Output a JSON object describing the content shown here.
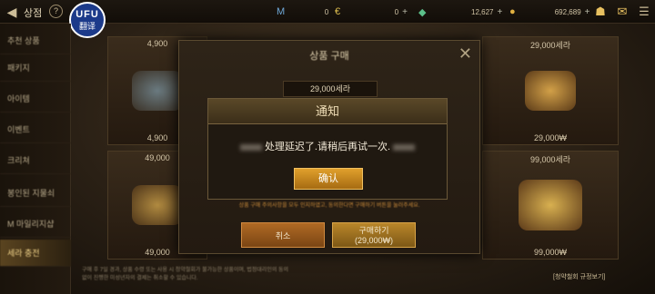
{
  "topbar": {
    "back_icon": "back-arrow-icon",
    "title": "상점",
    "help": "?",
    "currency": [
      {
        "icon": "M",
        "value": "0",
        "color": "#6fa8d8"
      },
      {
        "icon": "€",
        "value": "0",
        "color": "#e0c050"
      },
      {
        "icon": "◆",
        "value": "12,627",
        "color": "#5cc08a"
      },
      {
        "icon": "●",
        "value": "692,689",
        "color": "#e0b040"
      }
    ]
  },
  "translator_badge": {
    "line1": "UFU",
    "line2": "翻译"
  },
  "sidebar": {
    "items": [
      {
        "label": "추천 상품"
      },
      {
        "label": "패키지"
      },
      {
        "label": "아이템"
      },
      {
        "label": "이벤트"
      },
      {
        "label": "크리쳐"
      },
      {
        "label": "봉인된 지물쇠"
      },
      {
        "label": "M 마일리지샵"
      },
      {
        "label": "세라 충전"
      }
    ]
  },
  "cards": [
    {
      "top": "4,900",
      "bottom": "4,900"
    },
    {
      "top": "49,000",
      "bottom": "49,000"
    },
    {
      "top": "29,000세라",
      "bottom": "29,000₩"
    },
    {
      "top": "99,000세라",
      "bottom": "99,000₩"
    }
  ],
  "purchase_dialog": {
    "title": "상품 구매",
    "close": "✕",
    "amount": "29,000세라",
    "notice": "상품 구매 주의사항을 모두 인지하였고, 동의한다면 구매하기 버튼을 눌러주세요.",
    "cancel": "취소",
    "buy_line1": "구매하기",
    "buy_line2": "(29,000₩)"
  },
  "notice_dialog": {
    "title": "通知",
    "message": "处理延迟了.请稍后再试一次.",
    "confirm": "确认"
  },
  "footer": {
    "note": "구매 후 7일 경과, 상품 수령 또는 사용 시 청약철회가 불가능한 상품이며, 법정대리인의 동의 없이 진행한 미성년자의 결제는 취소할 수 있습니다.",
    "link": "[청약철회 규정보기]"
  }
}
